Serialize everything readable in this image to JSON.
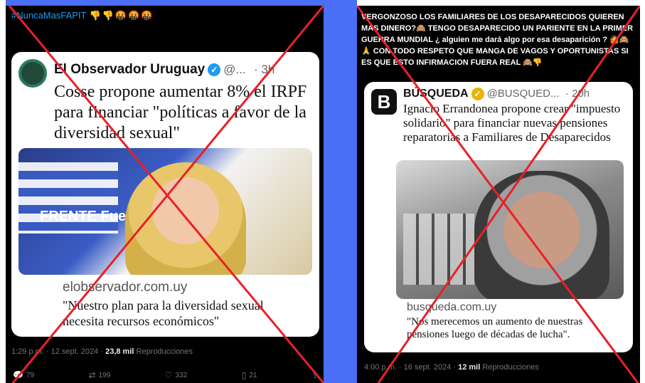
{
  "left": {
    "hashtag": "#NuncaMasFAPIT",
    "hashtag_emoji": "👎👎🤬🤬🤬",
    "quote": {
      "name": "El Observador Uruguay",
      "handle": "@...",
      "time": "· 3h",
      "text": "Cosse propone aumentar 8% el IRPF para financiar \"políticas a favor de la diversidad sexual\"",
      "media_banner": "FRENTE Fuerza Co",
      "domain": "elobservador.com.uy",
      "link_desc": "\"Nuestro plan para la diversidad sexual necesita recursos económicos\""
    },
    "meta_time": "1:29 p.m. · 12 sept. 2024 ·",
    "meta_views": "23,8 mil",
    "meta_label": "Reproducciones",
    "actions": {
      "replies": "79",
      "reposts": "199",
      "likes": "332",
      "bookmarks": "21"
    }
  },
  "right": {
    "top_text": "VERGONZOSO LOS FAMILIARES DE LOS DESAPARECIDOS QUIEREN MAS DINERO?🙈 TENGO DESAPARECIDO UN PARIENTE EN LA PRIMER GUERRA MUNDIAL ¿ alguien me dará algo por esa desaparición ? 🤷🙈 🙏 CON TODO RESPETO QUE MANGA DE VAGOS Y OPORTUNISTAS SI ES QUE ESTO INFIRMACION FUERA REAL 🙈👎",
    "quote": {
      "logo_letter": "B",
      "name": "BÚSQUEDA",
      "handle": "@BUSQUED...",
      "time": "· 20h",
      "text": "Ignacio Errandonea propone crear \"impuesto solidario\" para financiar nuevas pensiones reparatorias a Familiares de Desaparecidos",
      "domain": "busqueda.com.uy",
      "link_desc": "\"Nos merecemos un aumento de nuestras pensiones luego de décadas de lucha\"."
    },
    "meta_time": "4:00 p.m. · 16 sept. 2024 ·",
    "meta_views": "12 mil",
    "meta_label": "Reproducciones"
  },
  "colors": {
    "cross": "#e8202a",
    "band": "#4a6ef5",
    "link": "#1d9bf0"
  }
}
